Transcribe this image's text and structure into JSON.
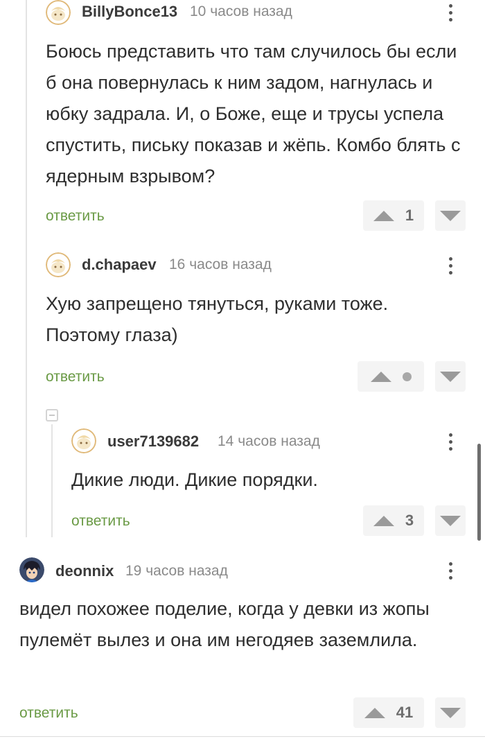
{
  "comments": [
    {
      "username": "BillyBonce13",
      "time": "10 часов назад",
      "avatar": "default-avatar-icon",
      "text": "Боюсь представить что там случилось бы если б она повернулась к ним задом, нагнулась и юбку задрала. И, о Боже, еще и трусы успела спустить, письку показав и жёпь. Комбо блять с ядерным взрывом?",
      "reply_label": "ответить",
      "score": "1"
    },
    {
      "username": "d.chapaev",
      "time": "16 часов назад",
      "avatar": "default-avatar-icon",
      "text": "Хую запрещено тянуться, руками тоже. Поэтому глаза)",
      "reply_label": "ответить",
      "score": null
    },
    {
      "username": "user7139682",
      "time": "14 часов назад",
      "avatar": "default-avatar-icon",
      "text": "Дикие люди. Дикие порядки.",
      "reply_label": "ответить",
      "score": "3"
    },
    {
      "username": "deonnix",
      "time": "19 часов назад",
      "avatar": "anime-character-avatar",
      "text": "видел похожее поделие, когда у девки из жопы пулемёт вылез и она им негодяев заземлила.",
      "reply_label": "ответить",
      "score": "41"
    }
  ],
  "colors": {
    "reply_link": "#6a9a45",
    "vote_bg": "#f4f4f4",
    "username": "#3a3a3a",
    "time": "#8a8a8a"
  }
}
